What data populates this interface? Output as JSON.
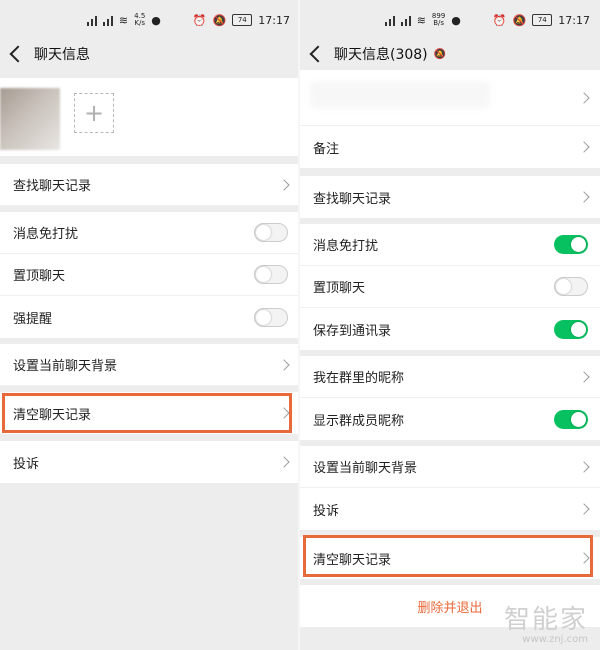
{
  "status_left": {
    "net_speed": "4.5\nK/s",
    "time": "17:17",
    "battery": "74"
  },
  "status_right": {
    "net_speed": "899\nB/s",
    "time": "17:17",
    "battery": "74"
  },
  "left": {
    "title": "聊天信息",
    "rows": {
      "search": "查找聊天记录",
      "dnd": "消息免打扰",
      "pin": "置顶聊天",
      "strong": "强提醒",
      "bg": "设置当前聊天背景",
      "clear": "清空聊天记录",
      "report": "投诉"
    },
    "toggles": {
      "dnd": "off",
      "pin": "off",
      "strong": "off"
    }
  },
  "right": {
    "title": "聊天信息(308)",
    "rows": {
      "remark": "备注",
      "search": "查找聊天记录",
      "dnd": "消息免打扰",
      "pin": "置顶聊天",
      "save": "保存到通讯录",
      "nickname": "我在群里的昵称",
      "show_nick": "显示群成员昵称",
      "bg": "设置当前聊天背景",
      "report": "投诉",
      "clear": "清空聊天记录"
    },
    "toggles": {
      "dnd": "on",
      "pin": "off",
      "save": "on",
      "show_nick": "on"
    },
    "exit_label": "删除并退出"
  },
  "watermark": {
    "main": "智能家",
    "sub": "www.znj.com"
  },
  "colors": {
    "accent": "#e8693a",
    "toggle_on": "#07c160"
  }
}
